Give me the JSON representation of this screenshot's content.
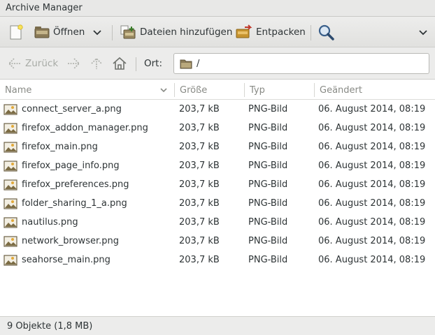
{
  "window": {
    "title": "Archive Manager"
  },
  "toolbar": {
    "open_label": "Öffnen",
    "add_files_label": "Dateien hinzufügen",
    "extract_label": "Entpacken"
  },
  "location": {
    "back_label": "Zurück",
    "location_label": "Ort:",
    "path": "/"
  },
  "columns": {
    "name": "Name",
    "size": "Größe",
    "type": "Typ",
    "modified": "Geändert"
  },
  "files": [
    {
      "name": "connect_server_a.png",
      "size": "203,7 kB",
      "type": "PNG-Bild",
      "modified": "06. August 2014, 08:19"
    },
    {
      "name": "firefox_addon_manager.png",
      "size": "203,7 kB",
      "type": "PNG-Bild",
      "modified": "06. August 2014, 08:19"
    },
    {
      "name": "firefox_main.png",
      "size": "203,7 kB",
      "type": "PNG-Bild",
      "modified": "06. August 2014, 08:19"
    },
    {
      "name": "firefox_page_info.png",
      "size": "203,7 kB",
      "type": "PNG-Bild",
      "modified": "06. August 2014, 08:19"
    },
    {
      "name": "firefox_preferences.png",
      "size": "203,7 kB",
      "type": "PNG-Bild",
      "modified": "06. August 2014, 08:19"
    },
    {
      "name": "folder_sharing_1_a.png",
      "size": "203,7 kB",
      "type": "PNG-Bild",
      "modified": "06. August 2014, 08:19"
    },
    {
      "name": "nautilus.png",
      "size": "203,7 kB",
      "type": "PNG-Bild",
      "modified": "06. August 2014, 08:19"
    },
    {
      "name": "network_browser.png",
      "size": "203,7 kB",
      "type": "PNG-Bild",
      "modified": "06. August 2014, 08:19"
    },
    {
      "name": "seahorse_main.png",
      "size": "203,7 kB",
      "type": "PNG-Bild",
      "modified": "06. August 2014, 08:19"
    }
  ],
  "status": {
    "text": "9 Objekte (1,8 MB)"
  }
}
